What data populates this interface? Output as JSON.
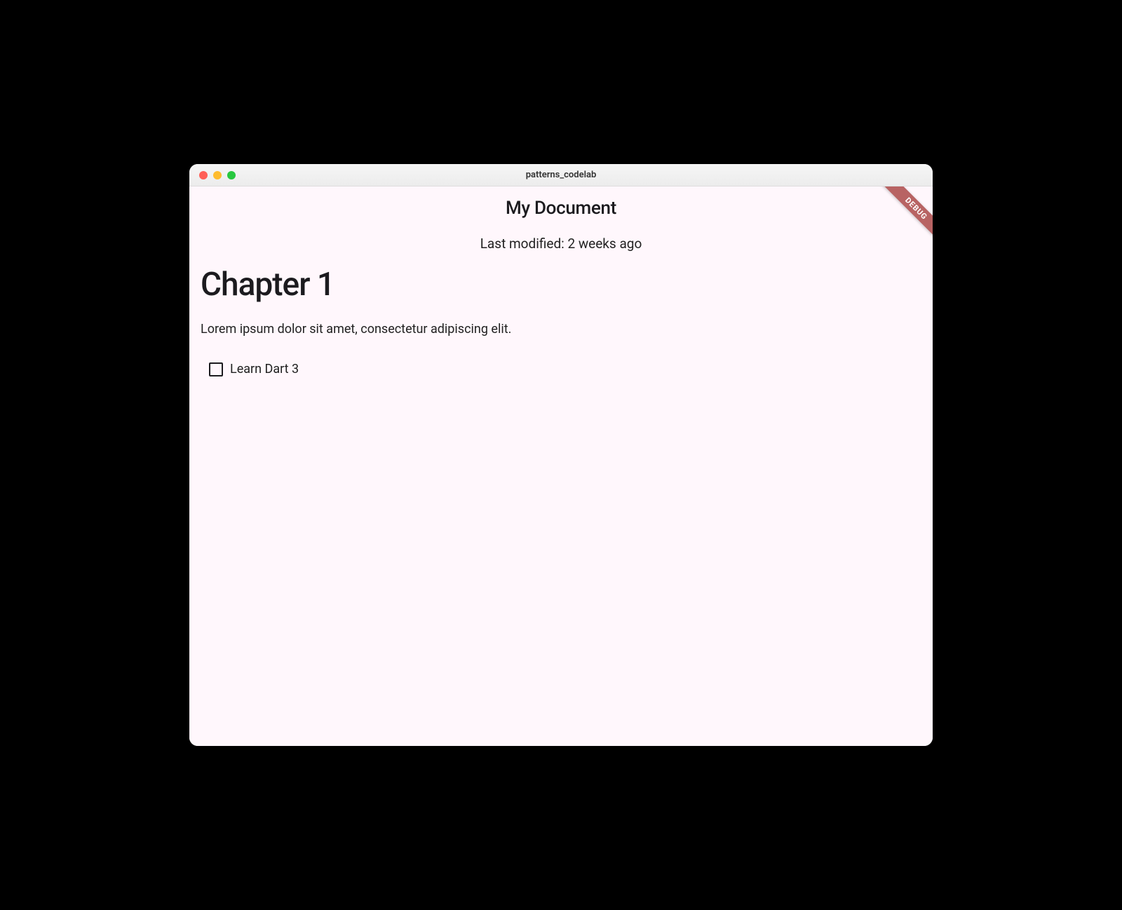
{
  "window": {
    "title": "patterns_codelab"
  },
  "header": {
    "title": "My Document",
    "last_modified": "Last modified: 2 weeks ago"
  },
  "content": {
    "heading": "Chapter 1",
    "body": "Lorem ipsum dolor sit amet, consectetur adipiscing elit.",
    "checkbox": {
      "label": "Learn Dart 3",
      "checked": false
    }
  },
  "debug_banner": "DEBUG"
}
